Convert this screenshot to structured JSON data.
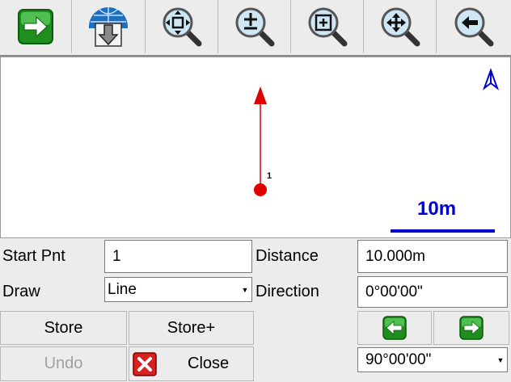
{
  "toolbar": {
    "buttons": [
      {
        "icon": "forward-arrow-icon"
      },
      {
        "icon": "globe-download-icon"
      },
      {
        "icon": "zoom-extents-icon"
      },
      {
        "icon": "zoom-in-out-icon"
      },
      {
        "icon": "zoom-window-icon"
      },
      {
        "icon": "zoom-pan-icon"
      },
      {
        "icon": "zoom-previous-icon"
      }
    ]
  },
  "map": {
    "point_label": "1",
    "scale_label": "10m",
    "line_color": "#e00000",
    "scale_color": "#0000d0"
  },
  "form": {
    "start_pnt_label": "Start Pnt",
    "start_pnt_value": "1",
    "draw_label": "Draw",
    "draw_value": "Line",
    "distance_label": "Distance",
    "distance_value": "10.000m",
    "direction_label": "Direction",
    "direction_value": "0°00'00\"",
    "angle_step_value": "90°00'00\""
  },
  "buttons": {
    "store": "Store",
    "store_plus": "Store+",
    "undo": "Undo",
    "close": "Close"
  }
}
